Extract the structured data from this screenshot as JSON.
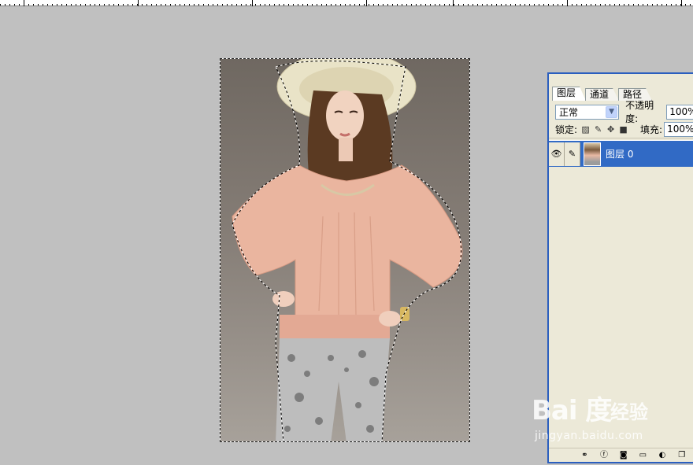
{
  "layers_panel": {
    "tabs": [
      "图层",
      "通道",
      "路径"
    ],
    "blend_mode": "正常",
    "opacity_label": "不透明度:",
    "opacity_value": "100%",
    "lock_label": "锁定:",
    "lock_icons": [
      "lock-transparent-icon",
      "lock-paint-icon",
      "lock-move-icon",
      "lock-all-icon"
    ],
    "fill_label": "填充:",
    "fill_value": "100%",
    "layers": [
      {
        "name": "图层 0",
        "visible": true,
        "selected": true
      }
    ],
    "bottom_icons": [
      "link-icon",
      "layer-style-icon",
      "mask-icon",
      "new-group-icon",
      "adjustment-icon",
      "new-layer-icon"
    ]
  },
  "watermark": {
    "logo": "Bai 度",
    "text": "经验",
    "url": "jingyan.baidu.com"
  },
  "colors": {
    "canvas_bg": "#c0c0c0",
    "panel_bg": "#ece9d8",
    "selected_layer": "#316ac5",
    "panel_border": "#2b5fbf"
  }
}
